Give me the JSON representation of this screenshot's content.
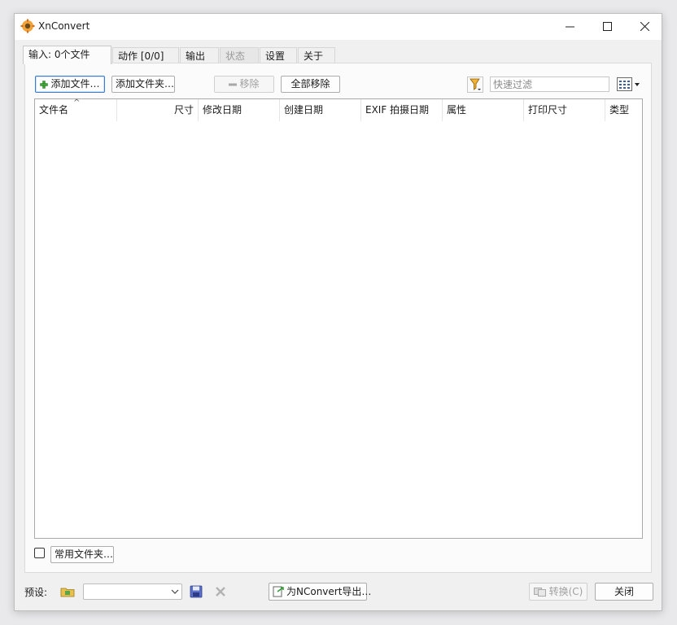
{
  "window": {
    "title": "XnConvert"
  },
  "tabs": [
    {
      "label": "输入: 0个文件"
    },
    {
      "label": "动作 [0/0]"
    },
    {
      "label": "输出"
    },
    {
      "label": "状态"
    },
    {
      "label": "设置"
    },
    {
      "label": "关于"
    }
  ],
  "toolbar": {
    "add_files": "添加文件…",
    "add_folder": "添加文件夹…",
    "remove": "移除",
    "remove_all": "全部移除",
    "filter_placeholder": "快速过滤"
  },
  "columns": [
    "文件名",
    "尺寸",
    "修改日期",
    "创建日期",
    "EXIF 拍摄日期",
    "属性",
    "打印尺寸",
    "类型"
  ],
  "favorite_folders_button": "常用文件夹…",
  "bottom": {
    "preset_label": "预设:",
    "preset_value": "",
    "export_button": "为NConvert导出…",
    "convert_button": "转换(C)",
    "close_button": "关闭"
  },
  "icons": {
    "app": "xnconvert-logo-icon",
    "add": "green-plus-icon",
    "remove": "minus-icon",
    "filter": "funnel-icon",
    "view": "grid-view-icon",
    "preset_open": "folder-open-icon",
    "preset_save": "floppy-disk-icon",
    "preset_delete": "delete-x-icon",
    "export": "export-script-icon",
    "convert": "convert-icon"
  },
  "colors": {
    "focus": "#3a7bd5",
    "panel": "#fbfbfb",
    "window": "#f0f0f0"
  }
}
